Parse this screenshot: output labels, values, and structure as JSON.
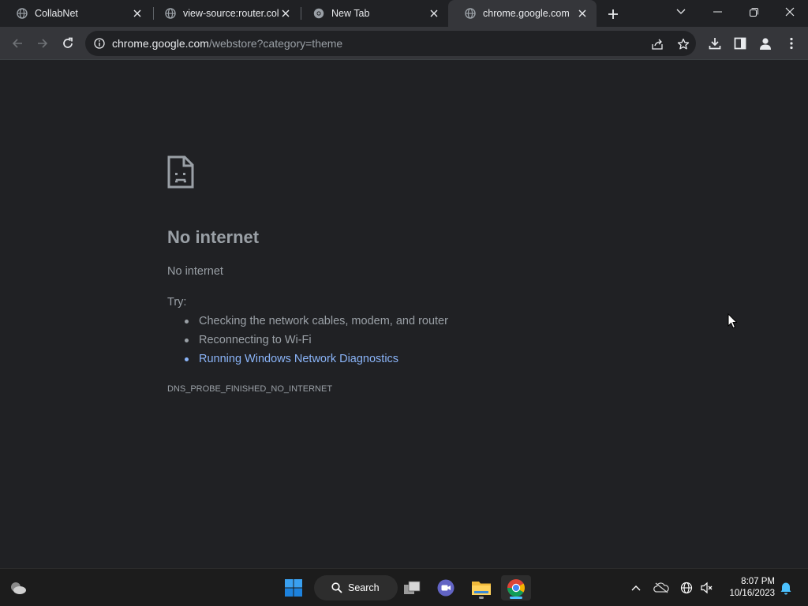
{
  "tabs": [
    {
      "title": "CollabNet",
      "icon": "globe-icon",
      "active": false
    },
    {
      "title": "view-source:router.colla",
      "icon": "globe-icon",
      "active": false
    },
    {
      "title": "New Tab",
      "icon": "chrome-icon",
      "active": false
    },
    {
      "title": "chrome.google.com",
      "icon": "globe-icon",
      "active": true
    }
  ],
  "omnibox": {
    "host": "chrome.google.com",
    "path": "/webstore?category=theme"
  },
  "error": {
    "title": "No internet",
    "subtitle": "No internet",
    "try_label": "Try:",
    "suggestions": [
      {
        "text": "Checking the network cables, modem, and router",
        "link": false
      },
      {
        "text": "Reconnecting to Wi-Fi",
        "link": false
      },
      {
        "text": "Running Windows Network Diagnostics",
        "link": true
      }
    ],
    "code": "DNS_PROBE_FINISHED_NO_INTERNET"
  },
  "taskbar": {
    "search_label": "Search",
    "time": "8:07 PM",
    "date": "10/16/2023"
  },
  "colors": {
    "background": "#202124",
    "toolbar": "#35363a",
    "link": "#8ab4f8",
    "text": "#9aa0a6",
    "taskbar": "#1c1c1c"
  }
}
